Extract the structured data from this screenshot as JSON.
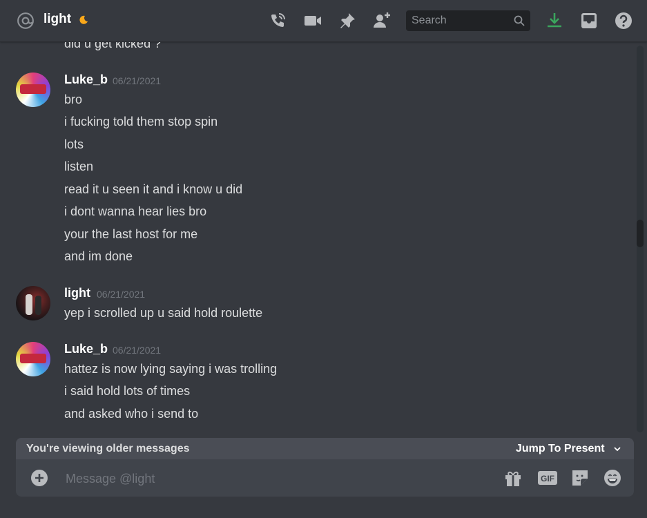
{
  "header": {
    "channel_name": "light",
    "search_placeholder": "Search",
    "icons": [
      "at-icon",
      "moon-icon",
      "call-icon",
      "video-icon",
      "pin-icon",
      "add-friend-icon",
      "search-icon",
      "download-icon",
      "inbox-icon",
      "help-icon"
    ],
    "download_color": "#3ba55d"
  },
  "messages": {
    "partial_line": "did u get kicked ?",
    "groups": [
      {
        "author": "Luke_b",
        "timestamp": "06/21/2021",
        "lines": [
          "bro",
          "i fucking told them stop spin",
          "lots",
          "listen",
          "read it u seen it and i know u did",
          "i dont wanna hear lies bro",
          "your the last host for me",
          "and im done"
        ]
      },
      {
        "author": "light",
        "timestamp": "06/21/2021",
        "lines": [
          "yep i scrolled up u said hold roulette"
        ]
      },
      {
        "author": "Luke_b",
        "timestamp": "06/21/2021",
        "lines": [
          "hattez is now lying saying i was trolling",
          "i said hold lots of times",
          "and asked who i send to"
        ]
      }
    ]
  },
  "older_bar": {
    "text": "You're viewing older messages",
    "jump_label": "Jump To Present"
  },
  "composer": {
    "placeholder": "Message @light",
    "gif_label": "GIF"
  },
  "colors": {
    "background": "#36393f",
    "input_bg": "#40444b",
    "search_bg": "#202225",
    "older_bar_bg": "#4a4d55"
  }
}
